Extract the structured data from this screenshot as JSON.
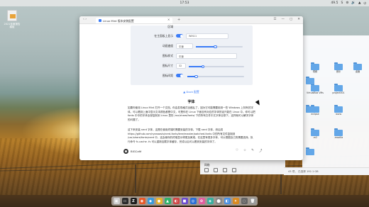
{
  "topbar": {
    "clock": "17:53",
    "tray_items": [
      "49.5",
      "S",
      "⚙",
      "🔊",
      "▲",
      "⏻"
    ]
  },
  "desktop": {
    "icon_label": "2021年度报告模板"
  },
  "browser": {
    "tab_title": "Linux Mint 版本安装配置",
    "card": {
      "rows": [
        {
          "label": "区域",
          "value": ""
        },
        {
          "label": "在主面板上显示",
          "value": "WIN11"
        },
        {
          "label": "动画速度",
          "value": "中速"
        },
        {
          "label": "图标样式",
          "value": "中速"
        },
        {
          "label": "图标尺寸",
          "value": "32"
        },
        {
          "label": "图标间距",
          "value": ""
        }
      ]
    },
    "caption": "▲ Dock 配置",
    "heading": "字体",
    "para1": "如果你使用 Linux Mint 打开一个文档，你会发现格式全都乱了，因为它可能需要用到一些 Windows 上特有的字体。可以看到上面中显示文本颜色都是中文，可是你在 Linux 下面没有对应的字体的话只能在 Linux 中。你可以把 fonts 中中的字体全部复制到 Linux 里的 /usr/share/fonts/ 下的所有文件中文字体目录下，这样就可以解决字体的问题了。",
    "para2": "这下来安装 nerd 字体，这是在使用终端时需要安装的字体。下载 nerd 字体，然后将 https://github.com/ryanoasis/nerd-fonts/tree/master/patched-fonts 中的所有文件复制到 /usr/share/fonts/nerd 中，这会使你的终端显示得更加美观。在这里有很多字体，可以根据自己的需要选择。执行命令 fc-cache -fv 可以重新加载字体缓存，完成以后可以看到安装的字体了。",
    "author": "BIGCafé",
    "action_icons": [
      "♡",
      "☆",
      "✎",
      "⤴"
    ]
  },
  "file_manager": {
    "folders": [
      {
        "name": "视频",
        "col": 0,
        "row": 0
      },
      {
        "name": "音乐",
        "col": 1,
        "row": 0
      },
      {
        "name": "桌面",
        "col": 2,
        "row": 0
      },
      {
        "name": "VirtualBox VMs",
        "col": 0,
        "row": 1
      },
      {
        "name": "project001",
        "col": 1,
        "row": 1
      },
      {
        "name": "eclipse",
        "col": 0,
        "row": 2
      },
      {
        "name": "icons",
        "col": 1,
        "row": 2
      },
      {
        "name": ".m2",
        "col": 0,
        "row": 3
      },
      {
        "name": ".mozilla",
        "col": 1,
        "row": 3
      }
    ],
    "status": "43 项，  已选择   192.1 GB"
  },
  "side_panel": {
    "label": "网络",
    "icons": [
      "home-icon",
      "desktop-icon",
      "folder-icon",
      "trash-icon"
    ]
  },
  "dock": {
    "apps": [
      {
        "name": "file-manager-icon",
        "glyph": "▣",
        "color": "#cfcfcf"
      },
      {
        "name": "terminal-icon",
        "glyph": "▭",
        "color": "#2b2b2b"
      },
      {
        "name": "zhihu-icon",
        "glyph": "Z",
        "color": "#1d1d1d"
      },
      {
        "name": "app-icon-4",
        "glyph": "◉",
        "color": "#e85a2a"
      },
      {
        "name": "app-icon-5",
        "glyph": "◆",
        "color": "#3a9bdc"
      },
      {
        "name": "app-icon-6",
        "glyph": "●",
        "color": "#e8b22a"
      },
      {
        "name": "app-icon-7",
        "glyph": "▲",
        "color": "#2fb36b"
      },
      {
        "name": "app-icon-8",
        "glyph": "◐",
        "color": "#d04848"
      },
      {
        "name": "app-icon-9",
        "glyph": "■",
        "color": "#6c4cd0"
      },
      {
        "name": "app-icon-10",
        "glyph": "◎",
        "color": "#2a6fd6"
      },
      {
        "name": "app-icon-11",
        "glyph": "✿",
        "color": "#e25d9f"
      },
      {
        "name": "app-icon-12",
        "glyph": "◈",
        "color": "#3bb0a0"
      },
      {
        "name": "app-icon-13",
        "glyph": "⬤",
        "color": "#888888"
      },
      {
        "name": "app-icon-14",
        "glyph": "◧",
        "color": "#4a90e2"
      },
      {
        "name": "app-icon-15",
        "glyph": "✦",
        "color": "#d98a20"
      },
      {
        "name": "app-icon-16",
        "glyph": "◌",
        "color": "#666666"
      },
      {
        "name": "trash-icon",
        "glyph": "🗑",
        "color": "#9a9a9a"
      }
    ]
  },
  "colors": {
    "accent": "#3b7cf7",
    "link": "#2a6fd6",
    "folder": "#63a7e8"
  }
}
